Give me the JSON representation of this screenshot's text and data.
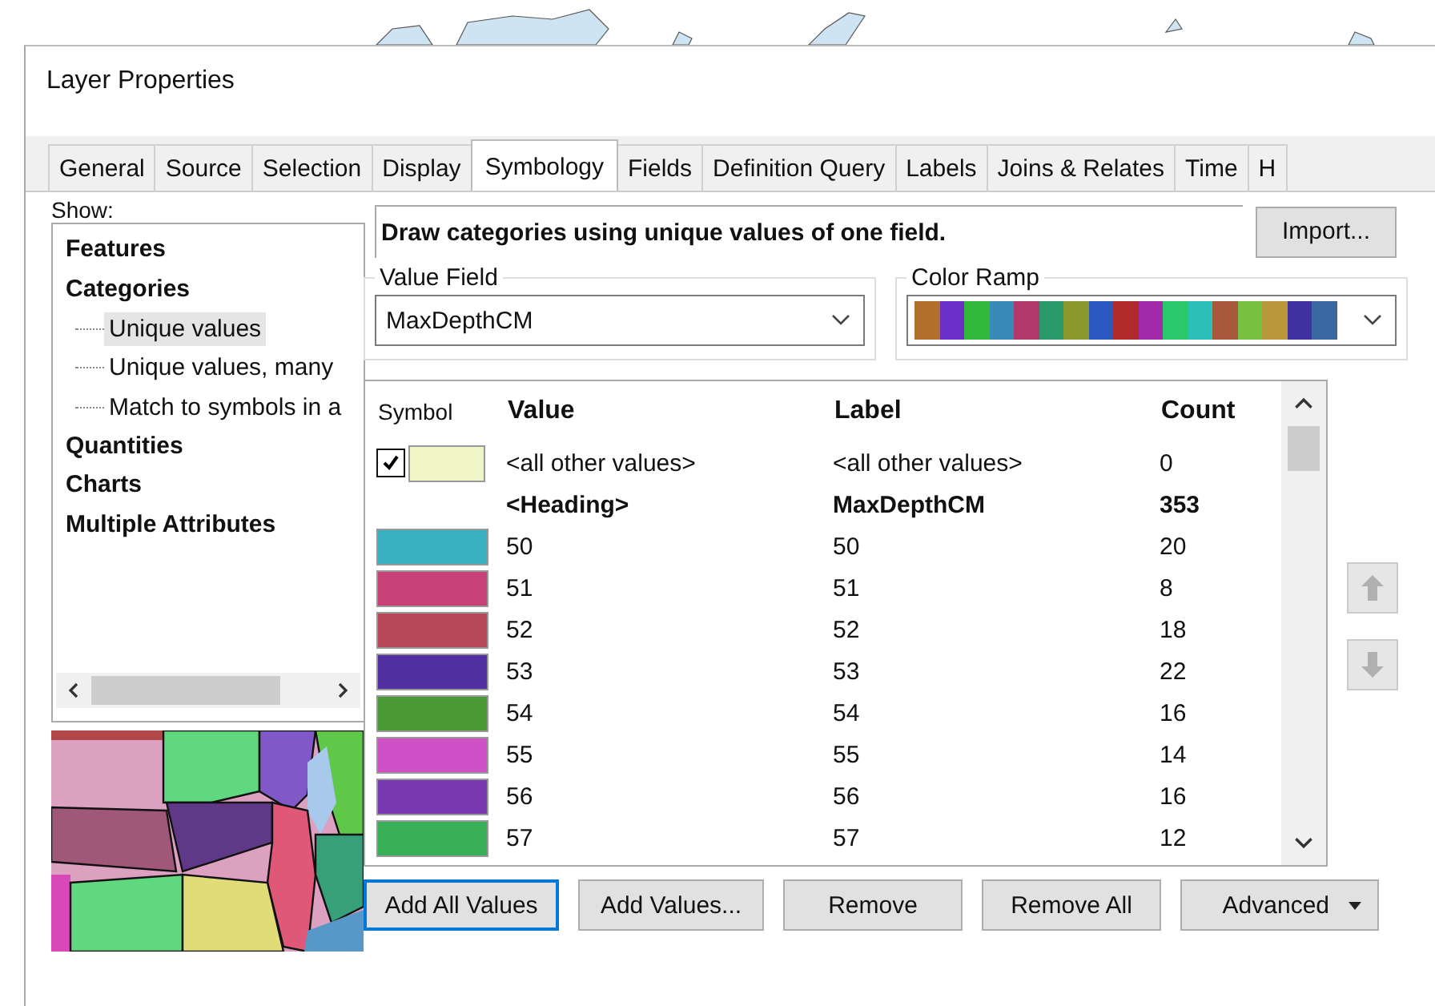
{
  "window": {
    "title": "Layer Properties"
  },
  "tabs": [
    {
      "label": "General",
      "selected": false
    },
    {
      "label": "Source",
      "selected": false
    },
    {
      "label": "Selection",
      "selected": false
    },
    {
      "label": "Display",
      "selected": false
    },
    {
      "label": "Symbology",
      "selected": true
    },
    {
      "label": "Fields",
      "selected": false
    },
    {
      "label": "Definition Query",
      "selected": false
    },
    {
      "label": "Labels",
      "selected": false
    },
    {
      "label": "Joins & Relates",
      "selected": false
    },
    {
      "label": "Time",
      "selected": false
    },
    {
      "label": "H",
      "selected": false
    }
  ],
  "show": {
    "label": "Show:",
    "items": [
      {
        "label": "Features",
        "selected": false
      },
      {
        "label": "Categories",
        "selected": false,
        "children": [
          {
            "label": "Unique values",
            "selected": true
          },
          {
            "label": "Unique values, many",
            "selected": false
          },
          {
            "label": "Match to symbols in a",
            "selected": false
          }
        ]
      },
      {
        "label": "Quantities",
        "selected": false
      },
      {
        "label": "Charts",
        "selected": false
      },
      {
        "label": "Multiple Attributes",
        "selected": false
      }
    ]
  },
  "description": "Draw categories using unique values of one field.",
  "import_button": "Import...",
  "value_field": {
    "label": "Value Field",
    "value": "MaxDepthCM"
  },
  "color_ramp": {
    "label": "Color Ramp",
    "colors": [
      {
        "color": "#b0702a"
      },
      {
        "color": "#6a2fc8"
      },
      {
        "color": "#30b83a"
      },
      {
        "color": "#3a8ab8"
      },
      {
        "color": "#b0386a"
      },
      {
        "color": "#2a9a6a"
      },
      {
        "color": "#8a9a2a"
      },
      {
        "color": "#2a5ac0"
      },
      {
        "color": "#b02a2a"
      },
      {
        "color": "#a02aa8"
      },
      {
        "color": "#2ac86a"
      },
      {
        "color": "#2ac0b8"
      },
      {
        "color": "#a8583a"
      },
      {
        "color": "#78c040"
      },
      {
        "color": "#b89838"
      },
      {
        "color": "#4030a0"
      },
      {
        "color": "#3a68a0"
      }
    ]
  },
  "table": {
    "columns": [
      "Symbol",
      "Value",
      "Label",
      "Count"
    ],
    "rows": [
      {
        "kind": "other",
        "checked": true,
        "color": "#f0f5c8",
        "value": "<all other values>",
        "label": "<all other values>",
        "count": "0"
      },
      {
        "kind": "heading",
        "value": "<Heading>",
        "label": "MaxDepthCM",
        "count": "353"
      },
      {
        "kind": "value",
        "color": "#38b0c0",
        "value": "50",
        "label": "50",
        "count": "20"
      },
      {
        "kind": "value",
        "color": "#c84078",
        "value": "51",
        "label": "51",
        "count": "8"
      },
      {
        "kind": "value",
        "color": "#b84858",
        "value": "52",
        "label": "52",
        "count": "18"
      },
      {
        "kind": "value",
        "color": "#5030a0",
        "value": "53",
        "label": "53",
        "count": "22"
      },
      {
        "kind": "value",
        "color": "#4a9a38",
        "value": "54",
        "label": "54",
        "count": "16"
      },
      {
        "kind": "value",
        "color": "#d050c8",
        "value": "55",
        "label": "55",
        "count": "14"
      },
      {
        "kind": "value",
        "color": "#7838b0",
        "value": "56",
        "label": "56",
        "count": "16"
      },
      {
        "kind": "value",
        "color": "#38b058",
        "value": "57",
        "label": "57",
        "count": "12"
      }
    ]
  },
  "move_buttons": {
    "up_disabled": true,
    "down_disabled": true
  },
  "buttons": [
    {
      "label": "Add All Values",
      "focused": true
    },
    {
      "label": "Add Values...",
      "focused": false
    },
    {
      "label": "Remove",
      "focused": false
    },
    {
      "label": "Remove All",
      "focused": false
    },
    {
      "label": "Advanced",
      "focused": false,
      "dropdown": true
    }
  ]
}
